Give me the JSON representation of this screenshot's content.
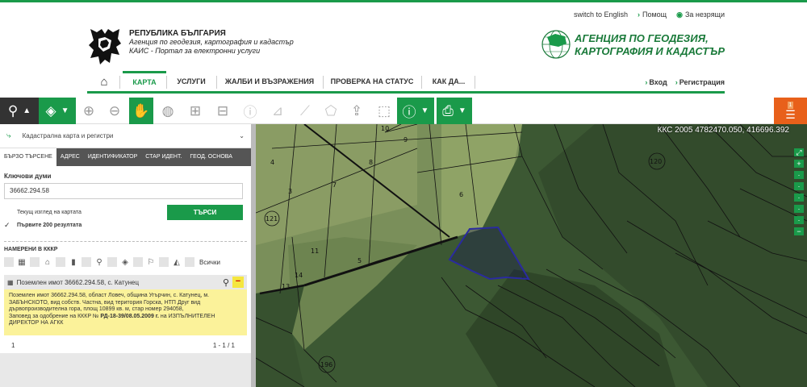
{
  "util_nav": {
    "english": "switch to English",
    "help": "Помощ",
    "accessible": "За незрящи"
  },
  "header": {
    "org_line1": "РЕПУБЛИКА БЪЛГАРИЯ",
    "org_line2": "Агенция по геодезия, картография и кадастър",
    "org_line3": "КАИС - Портал за електронни услуги",
    "agency_line1": "АГЕНЦИЯ ПО ГЕОДЕЗИЯ,",
    "agency_line2": "КАРТОГРАФИЯ И КАДАСТЪР"
  },
  "main_nav": {
    "map": "КАРТА",
    "services": "УСЛУГИ",
    "complaints": "ЖАЛБИ И ВЪЗРАЖЕНИЯ",
    "status": "ПРОВЕРКА НА СТАТУС",
    "howto": "КАК ДА...",
    "login": "Вход",
    "register": "Регистрация"
  },
  "toolbar": {
    "badge": "1",
    "icons": [
      "search-icon",
      "layers-icon",
      "zoom-in-icon",
      "zoom-out-icon",
      "pan-hand-icon",
      "globe-icon",
      "select-add-icon",
      "select-remove-icon",
      "info-icon",
      "measure-area-icon",
      "ruler-icon",
      "polygon-icon",
      "upload-icon",
      "select-rect-icon",
      "info-layers-icon",
      "print-icon",
      "menu-icon"
    ]
  },
  "sidebar": {
    "layer_select": "Кадастрална карта и регистри",
    "tabs": [
      "БЪРЗО ТЪРСЕНЕ",
      "АДРЕС",
      "ИДЕНТИФИКАТОР",
      "СТАР ИДЕНТ.",
      "ГЕОД. ОСНОВА"
    ],
    "keywords_label": "Ключови думи",
    "keywords_value": "36662.294.58",
    "current_view_label": "Текущ изглед на картата",
    "first200_label": "Първите 200 резултата",
    "search_button": "ТЪРСИ",
    "found_header": "НАМЕРЕНИ В КККР",
    "filter_all": "Всички",
    "result_title": "Поземлен имот 36662.294.58, с. Катунец",
    "result_text": "Поземлен имот 36662.294.58, област Ловеч, община Угърчин, с. Катунец, м. ЗАБЪНСКОТО, вид собств. Частна, вид територия Горска, НТП Друг вид дървопроизводителна гора, площ 10899 кв. м, стар номер 294058,",
    "result_text2_prefix": "Заповед за одобрение на КККР №",
    "result_text2_bold": "РД-18-39/08.05.2009 г.",
    "result_text2_suffix": "на ИЗПЪЛНИТЕЛЕН ДИРЕКТОР НА АГКК",
    "page_current": "1",
    "page_range": "1 - 1 / 1"
  },
  "map": {
    "coords": "ККС 2005 4782470.050, 416696.392",
    "parcel_labels": [
      "10",
      "9",
      "8",
      "7",
      "6",
      "5",
      "3",
      "4",
      "121",
      "120",
      "11",
      "14",
      "13",
      "196"
    ]
  },
  "colors": {
    "accent": "#1a9a4a",
    "orange": "#e8601a",
    "highlight": "#fbf29a",
    "parcel": "#2a2aa0"
  }
}
